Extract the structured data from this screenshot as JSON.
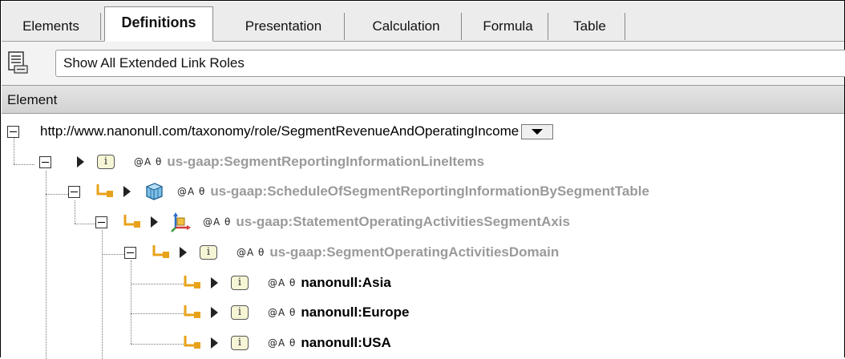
{
  "tabs": [
    {
      "label": "Elements"
    },
    {
      "label": "Definitions"
    },
    {
      "label": "Presentation"
    },
    {
      "label": "Calculation"
    },
    {
      "label": "Formula"
    },
    {
      "label": "Table"
    }
  ],
  "active_tab": "Definitions",
  "toolbar": {
    "roles_dropdown": "Show All Extended Link Roles"
  },
  "column_header": "Element",
  "tree": {
    "root": "http://www.nanonull.com/taxonomy/role/SegmentRevenueAndOperatingIncome",
    "items": [
      {
        "name": "us-gaap:SegmentReportingInformationLineItems",
        "symbols": "@A θ",
        "icon": "item-icon"
      },
      {
        "name": "us-gaap:ScheduleOfSegmentReportingInformationBySegmentTable",
        "symbols": "@A θ",
        "icon": "hypercube-icon"
      },
      {
        "name": "us-gaap:StatementOperatingActivitiesSegmentAxis",
        "symbols": "@A θ",
        "icon": "dimension-icon"
      },
      {
        "name": "us-gaap:SegmentOperatingActivitiesDomain",
        "symbols": "@A θ",
        "icon": "item-icon"
      },
      {
        "name": "nanonull:Asia",
        "symbols": "@A θ",
        "icon": "item-icon"
      },
      {
        "name": "nanonull:Europe",
        "symbols": "@A θ",
        "icon": "item-icon"
      },
      {
        "name": "nanonull:USA",
        "symbols": "@A θ",
        "icon": "item-icon"
      }
    ]
  },
  "item_icon_glyph": "i",
  "colors": {
    "grey_text": "#9a9a9a",
    "link_orange": "#e8a21a",
    "hypercube_blue": "#3a86c8"
  }
}
